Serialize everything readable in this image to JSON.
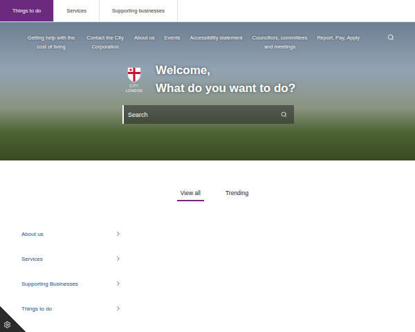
{
  "top_tabs": [
    {
      "label": "Things to do",
      "selected": true
    },
    {
      "label": "Services",
      "selected": false
    },
    {
      "label": "Supporting businesses",
      "selected": false
    }
  ],
  "nav": [
    "Getting help with the cost of living",
    "Contact the City Corporation",
    "About us",
    "Events",
    "Accessibility statement",
    "Councillors, committees and meetings",
    "Report, Pay, Apply"
  ],
  "logo": {
    "lines": [
      "CITY",
      "LONDON"
    ]
  },
  "hero": {
    "title_lines": [
      "Welcome,",
      "What do you want to do?"
    ]
  },
  "search": {
    "placeholder": "Search"
  },
  "view_tabs": [
    {
      "label": "View all",
      "selected": true
    },
    {
      "label": "Trending",
      "selected": false
    }
  ],
  "list": [
    "About us",
    "Services",
    "Supporting Businesses",
    "Things to do"
  ]
}
